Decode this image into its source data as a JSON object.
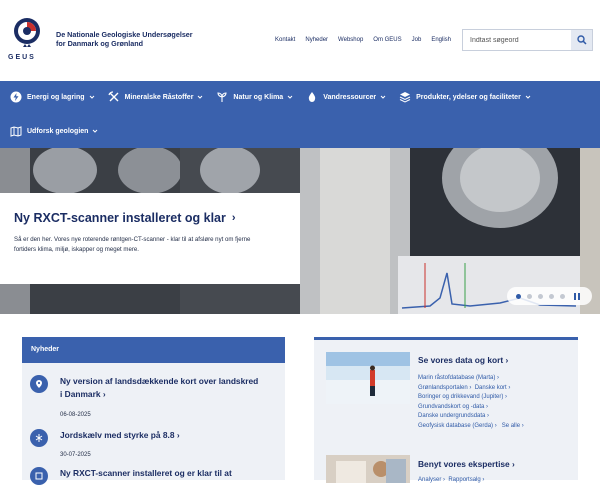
{
  "header": {
    "logo_text": "GEUS",
    "org_line1": "De Nationale Geologiske Undersøgelser",
    "org_line2": "for Danmark og Grønland",
    "topnav": [
      "Kontakt",
      "Nyheder",
      "Webshop",
      "Om GEUS",
      "Job",
      "English"
    ],
    "search_placeholder": "Indtast søgeord"
  },
  "mainnav": {
    "items": [
      {
        "label": "Energi og lagring",
        "icon": "energy-icon"
      },
      {
        "label": "Mineralske Råstoffer",
        "icon": "pickaxe-icon"
      },
      {
        "label": "Natur og Klima",
        "icon": "leaf-icon"
      },
      {
        "label": "Vandressourcer",
        "icon": "water-drop-icon"
      },
      {
        "label": "Produkter, ydelser og faciliteter",
        "icon": "layers-icon"
      },
      {
        "label": "Udforsk geologien",
        "icon": "map-icon"
      }
    ]
  },
  "hero": {
    "title": "Ny RXCT-scanner installeret og klar",
    "text_line1": "Så er den her. Vores nye roterende røntgen-CT-scanner - klar til at afsløre nyt om fjerne",
    "text_line2": "fortiders klima, miljø, iskapper og meget mere."
  },
  "news": {
    "heading": "Nyheder",
    "items": [
      {
        "title_line1": "Ny version af landsdækkende kort over landskred",
        "title_line2": "i Danmark",
        "date": "06-08-2025"
      },
      {
        "title_line1": "Jordskælv med styrke på 8.8",
        "title_line2": "",
        "date": "30-07-2025"
      },
      {
        "title_line1": "Ny RXCT-scanner installeret og er klar til at",
        "title_line2": "",
        "date": ""
      }
    ]
  },
  "data_panel": {
    "title": "Se vores data og kort",
    "links": [
      "Marin råstofdatabase (Marta)",
      "Grønlandsportalen",
      "Danske kort",
      "Boringer og drikkevand (Jupiter)",
      "Grundvandskort og -data",
      "Danske undergrundsdata",
      "Geofysisk database (Gerda)",
      "Se alle"
    ],
    "title2": "Benyt vores ekspertise",
    "links2": [
      "Analyser",
      "Rapportsalg"
    ]
  },
  "colors": {
    "brand": "#3a61ad",
    "navy": "#1b2d63"
  }
}
